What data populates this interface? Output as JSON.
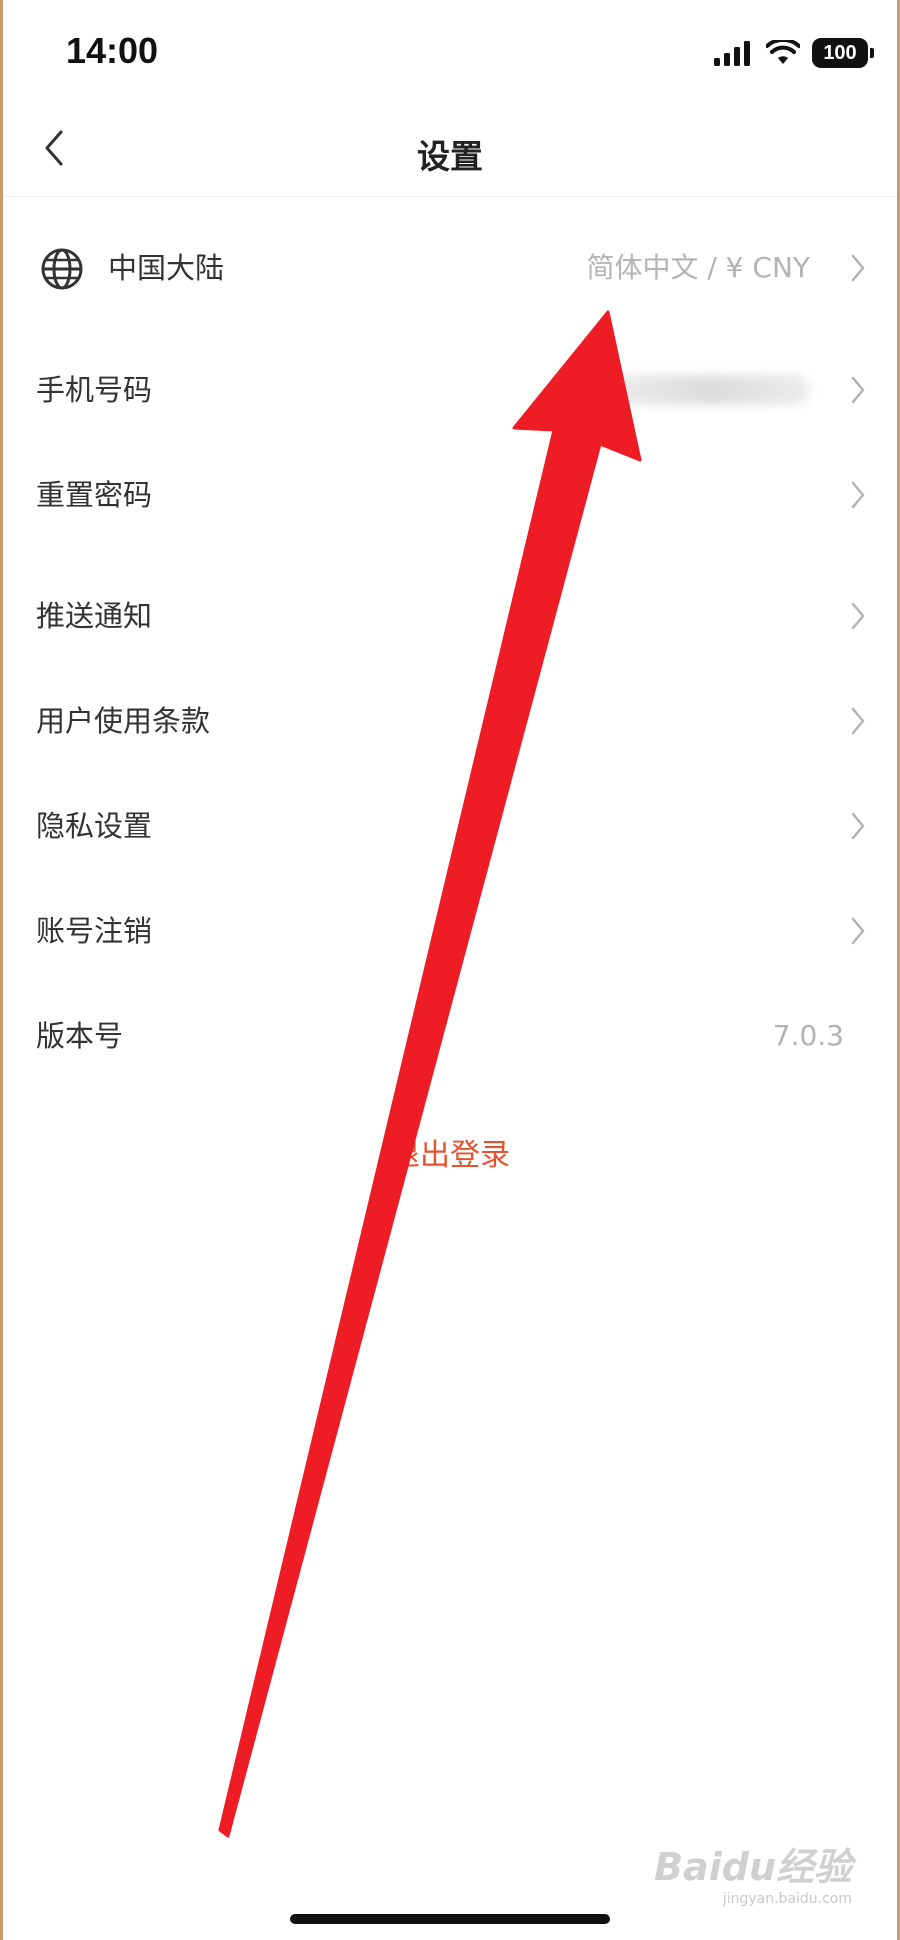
{
  "status_bar": {
    "time": "14:00",
    "battery": "100"
  },
  "navbar": {
    "title": "设置",
    "back_icon": "chevron-left-icon"
  },
  "region": {
    "label": "中国大陆",
    "value": "简体中文 / ¥ CNY",
    "icon": "globe-icon"
  },
  "settings": [
    {
      "label": "手机号码"
    },
    {
      "label": "重置密码"
    },
    {
      "label": "推送通知"
    },
    {
      "label": "用户使用条款"
    },
    {
      "label": "隐私设置"
    },
    {
      "label": "账号注销"
    }
  ],
  "version": {
    "label": "版本号",
    "value": "7.0.3"
  },
  "logout_label": "退出登录",
  "watermark": {
    "text": "Baidu经验",
    "url": "jingyan.baidu.com"
  },
  "colors": {
    "accent": "#e4532f",
    "annotation_arrow": "#ee1c25"
  }
}
